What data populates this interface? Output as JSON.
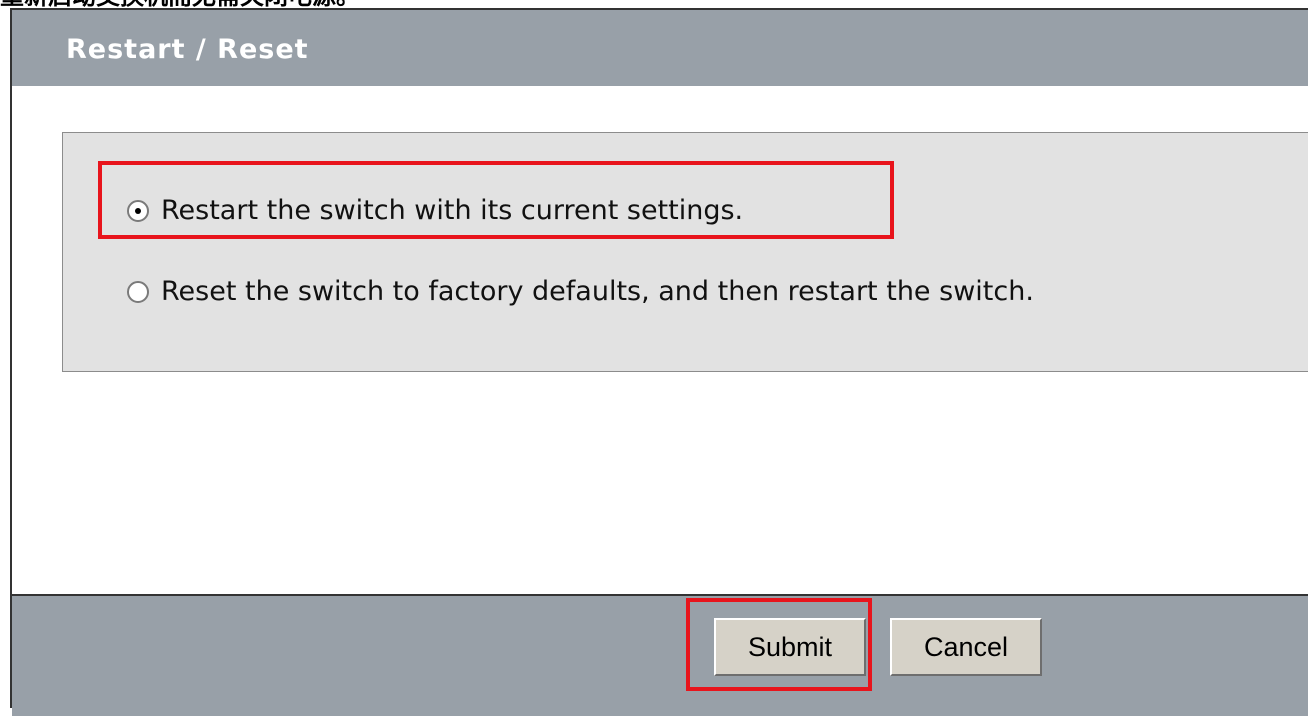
{
  "caption": "重新启动交换机而无需关闭电源。",
  "dialog": {
    "title": "Restart / Reset"
  },
  "options": [
    {
      "label": "Restart the switch with its current settings.",
      "selected": true
    },
    {
      "label": "Reset the switch to factory defaults, and then restart the switch.",
      "selected": false
    }
  ],
  "buttons": {
    "submit_label": "Submit",
    "cancel_label": "Cancel"
  },
  "colors": {
    "title_bar": "#98a0a8",
    "panel": "#e2e2e2",
    "highlight": "#e8141c"
  }
}
